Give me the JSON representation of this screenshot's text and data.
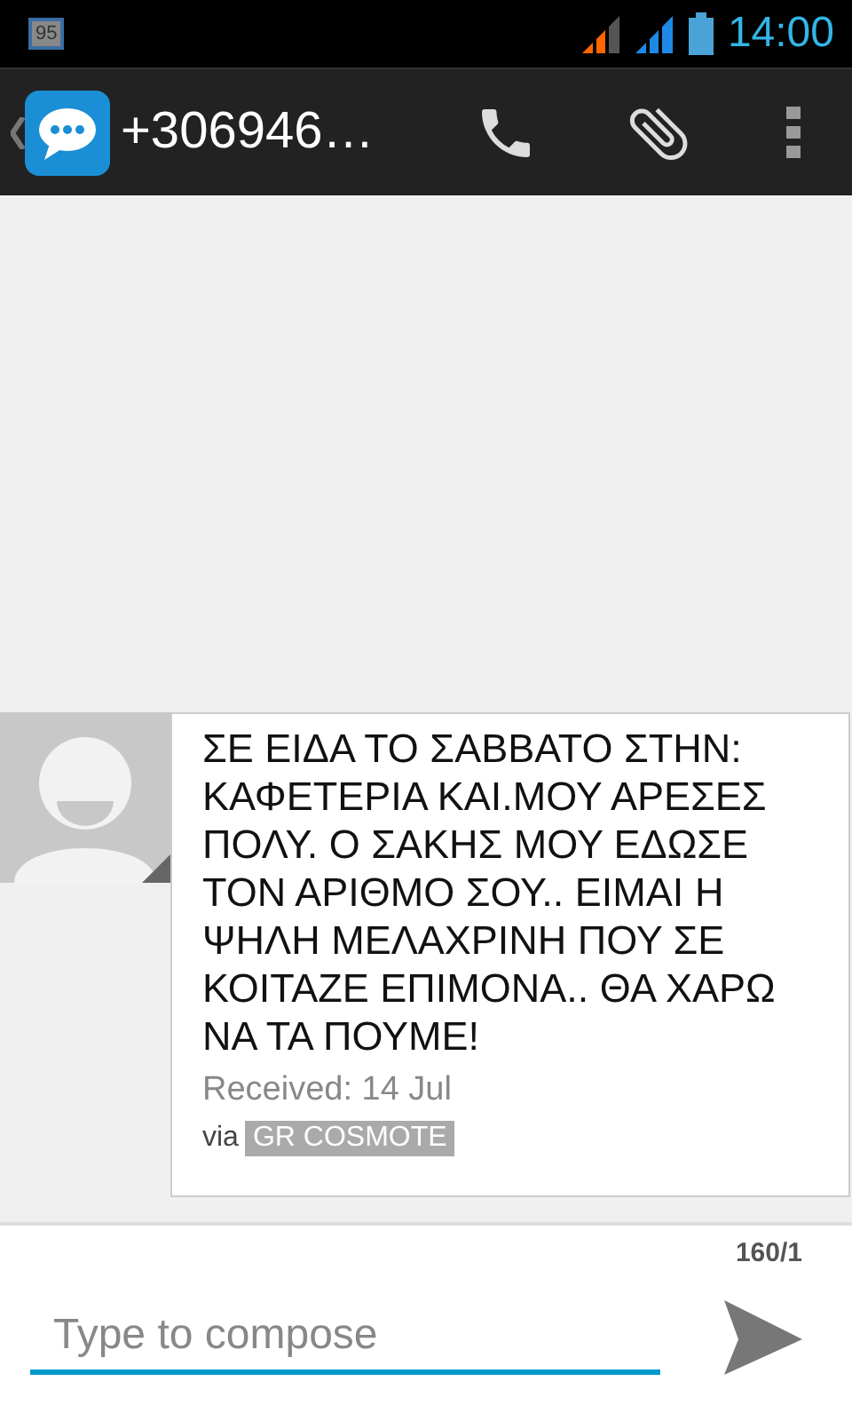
{
  "status_bar": {
    "notification": "95",
    "time": "14:00"
  },
  "action_bar": {
    "title": "+306946…"
  },
  "message": {
    "text": "ΣΕ ΕΙΔΑ ΤΟ ΣΑΒΒΑΤΟ ΣΤΗΝ:\nΚΑΦΕΤΕΡΙΑ ΚΑΙ.ΜΟΥ ΑΡΕΣΕΣ\nΠΟΛΥ. Ο ΣΑΚΗΣ ΜΟΥ ΕΔΩΣΕ\nΤΟΝ ΑΡΙΘΜΟ ΣΟΥ.. ΕΙΜΑΙ Η\nΨΗΛΗ ΜΕΛΑΧΡΙΝΗ ΠΟΥ ΣΕ\nΚΟΙΤΑΖΕ ΕΠΙΜΟΝΑ.. ΘΑ ΧΑΡΩ\nΝΑ ΤΑ ΠΟΥΜΕ!",
    "received": "Received: 14 Jul",
    "via": "via",
    "carrier": "GR COSMOTE"
  },
  "compose": {
    "counter": "160/1",
    "placeholder": "Type to compose"
  }
}
